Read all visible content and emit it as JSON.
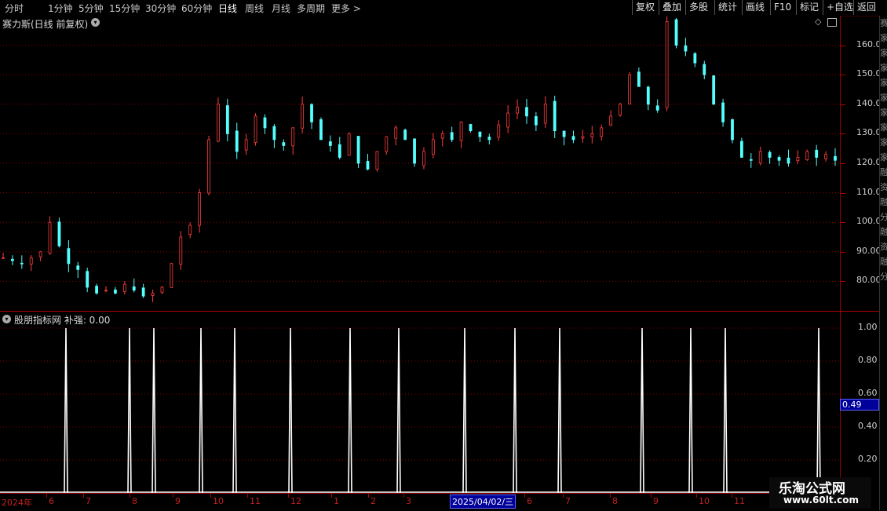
{
  "toolbar": {
    "periods": [
      "分时",
      "1分钟",
      "5分钟",
      "15分钟",
      "30分钟",
      "60分钟",
      "日线",
      "周线",
      "月线",
      "多周期",
      "更多 >"
    ],
    "active_period": "日线",
    "right_buttons": [
      "复权",
      "叠加",
      "多股",
      "统计",
      "画线",
      "F10",
      "标记",
      "+自选",
      "返回"
    ]
  },
  "main_pane": {
    "title": "赛力斯(日线 前复权)",
    "price_labels": [
      "160.0",
      "150.0",
      "140.0",
      "130.0",
      "120.0",
      "110.0",
      "100.0",
      "90.00",
      "80.00"
    ]
  },
  "indicator_pane": {
    "title": "股朋指标网 补强: 0.00",
    "value_labels": [
      "1.00",
      "0.80",
      "0.60",
      "0.40",
      "0.20"
    ],
    "cursor_value": "0.49"
  },
  "date_axis": {
    "year_label": "2024年",
    "month_labels": [
      "6",
      "7",
      "8",
      "9",
      "10",
      "11",
      "12",
      "1",
      "2",
      "3",
      "6",
      "7",
      "8",
      "9",
      "10",
      "11"
    ],
    "cursor_date": "2025/04/02/三"
  },
  "sidebar_glyphs": "赛家家家家家家家家家融资融分融资融分",
  "watermark": {
    "title": "乐淘公式网",
    "url": "www.60lt.com"
  },
  "colors": {
    "up": "#ff3c3c",
    "down": "#54ffff",
    "grid": "#8a0000",
    "signal": "#ffffff"
  },
  "chart_data": [
    {
      "type": "candlestick",
      "title": "赛力斯(日线 前复权)",
      "ylim": [
        70,
        170
      ],
      "x_months": [
        "2024-05",
        "2024-06",
        "2024-07",
        "2024-08",
        "2024-09",
        "2024-10",
        "2024-11",
        "2024-12",
        "2025-01",
        "2025-02",
        "2025-03",
        "2025-04",
        "2025-05",
        "2025-06",
        "2025-07",
        "2025-08",
        "2025-09",
        "2025-10",
        "2025-11",
        "2025-12"
      ],
      "close_path": [
        88,
        87,
        86,
        88,
        90,
        100,
        92,
        86,
        84,
        78,
        76,
        77,
        76,
        79,
        77,
        75,
        76,
        78,
        86,
        95,
        99,
        110,
        128,
        140,
        130,
        124,
        128,
        136,
        132,
        128,
        126,
        132,
        140,
        134,
        128,
        126,
        122,
        130,
        120,
        118,
        124,
        129,
        132,
        128,
        120,
        124,
        128,
        130,
        128,
        134,
        131,
        129,
        128,
        133,
        137,
        139,
        136,
        133,
        140,
        131,
        129,
        128,
        129,
        130,
        132,
        136,
        140,
        150,
        146,
        140,
        138,
        168,
        160,
        158,
        154,
        150,
        140,
        134,
        128,
        122,
        121,
        124,
        122,
        121,
        120,
        122,
        124,
        122,
        123,
        121
      ]
    },
    {
      "type": "bar",
      "title": "股朋指标网 补强",
      "ylim": [
        0,
        1.1
      ],
      "signal_value": 1.0,
      "signal_months": [
        "2024-06",
        "2024-08",
        "2024-08",
        "2024-09",
        "2024-10",
        "2024-11",
        "2025-01",
        "2025-01",
        "2025-03",
        "2025-04",
        "2025-06",
        "2025-07",
        "2025-09",
        "2025-10",
        "2025-10",
        "2025-12"
      ]
    }
  ]
}
